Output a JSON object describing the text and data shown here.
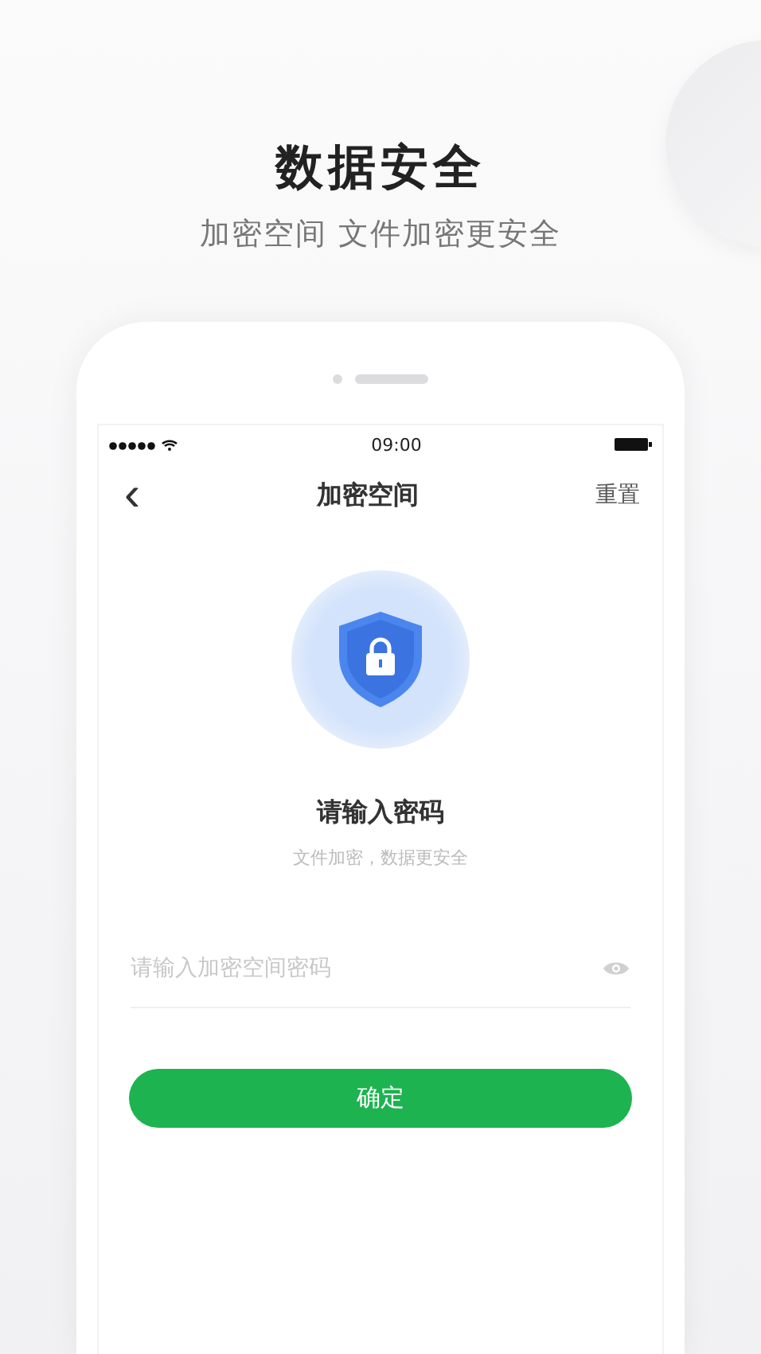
{
  "headline": "数据安全",
  "subheadline": "加密空间 文件加密更安全",
  "status_bar": {
    "time": "09:00"
  },
  "nav": {
    "back": "‹",
    "title": "加密空间",
    "action": "重置"
  },
  "prompt": {
    "title": "请输入密码",
    "subtitle": "文件加密，数据更安全"
  },
  "password_field": {
    "placeholder": "请输入加密空间密码"
  },
  "buttons": [
    "确定"
  ]
}
